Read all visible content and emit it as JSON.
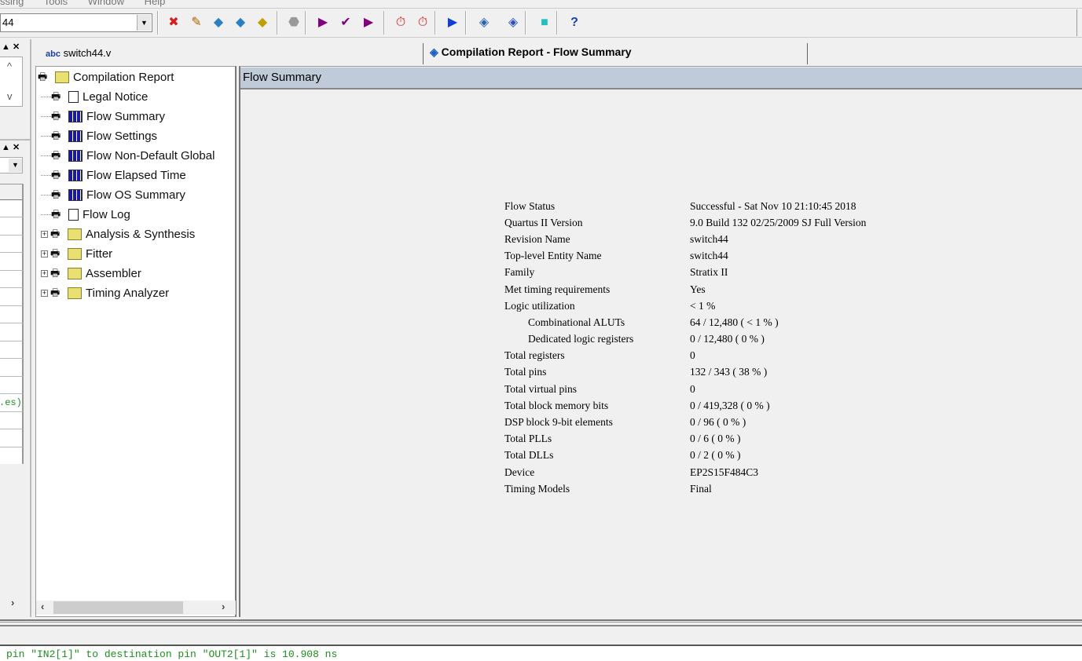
{
  "menubar": {
    "items": [
      "ssing",
      "Tools",
      "Window",
      "Help"
    ]
  },
  "toolbar": {
    "project_combo": "44",
    "icons": [
      "compile-stop-icon",
      "edit-icon",
      "analysis-icon",
      "check-icon",
      "fitter-icon",
      "stop-icon",
      "start-icon",
      "start-check-icon",
      "start-timing-icon",
      "timing-icon",
      "timer-icon",
      "simulation-icon",
      "report-icon",
      "chip-planner-icon",
      "programmer-icon",
      "help-icon"
    ]
  },
  "left_panel": {
    "green_fragment": ".es)"
  },
  "tabs": [
    {
      "label": "switch44.v",
      "icon": "verilog-file-icon"
    },
    {
      "label": "Compilation Report - Flow Summary",
      "icon": "report-icon"
    }
  ],
  "tree": {
    "root": "Compilation Report",
    "items": [
      {
        "label": "Legal Notice",
        "icon": "document-icon"
      },
      {
        "label": "Flow Summary",
        "icon": "table-icon"
      },
      {
        "label": "Flow Settings",
        "icon": "table-icon"
      },
      {
        "label": "Flow Non-Default Global",
        "icon": "table-icon"
      },
      {
        "label": "Flow Elapsed Time",
        "icon": "table-icon"
      },
      {
        "label": "Flow OS Summary",
        "icon": "table-icon"
      },
      {
        "label": "Flow Log",
        "icon": "document-icon"
      },
      {
        "label": "Analysis & Synthesis",
        "icon": "folder-icon"
      },
      {
        "label": "Fitter",
        "icon": "folder-icon"
      },
      {
        "label": "Assembler",
        "icon": "folder-icon"
      },
      {
        "label": "Timing Analyzer",
        "icon": "folder-icon"
      }
    ]
  },
  "main": {
    "header": "Flow Summary",
    "rows": [
      {
        "label": "Flow Status",
        "value": "Successful - Sat Nov 10 21:10:45 2018"
      },
      {
        "label": "Quartus II Version",
        "value": "9.0 Build 132 02/25/2009 SJ Full Version"
      },
      {
        "label": "Revision Name",
        "value": "switch44"
      },
      {
        "label": "Top-level Entity Name",
        "value": "switch44"
      },
      {
        "label": "Family",
        "value": "Stratix II"
      },
      {
        "label": "Met timing requirements",
        "value": "Yes"
      },
      {
        "label": "Logic utilization",
        "value": "< 1 %"
      },
      {
        "label": "Combinational ALUTs",
        "value": "64 / 12,480 ( < 1 % )",
        "indent": true
      },
      {
        "label": "Dedicated logic registers",
        "value": "0 / 12,480 ( 0 % )",
        "indent": true
      },
      {
        "label": "Total registers",
        "value": "0"
      },
      {
        "label": "Total pins",
        "value": "132 / 343 ( 38 % )"
      },
      {
        "label": "Total virtual pins",
        "value": "0"
      },
      {
        "label": "Total block memory bits",
        "value": "0 / 419,328 ( 0 % )"
      },
      {
        "label": "DSP block 9-bit elements",
        "value": "0 / 96 ( 0 % )"
      },
      {
        "label": "Total PLLs",
        "value": "0 / 6 ( 0 % )"
      },
      {
        "label": "Total DLLs",
        "value": "0 / 2 ( 0 % )"
      },
      {
        "label": "Device",
        "value": "EP2S15F484C3"
      },
      {
        "label": "Timing Models",
        "value": "Final"
      }
    ]
  },
  "messages": {
    "line": "pin \"IN2[1]\" to destination pin \"OUT2[1]\" is 10.908 ns"
  }
}
